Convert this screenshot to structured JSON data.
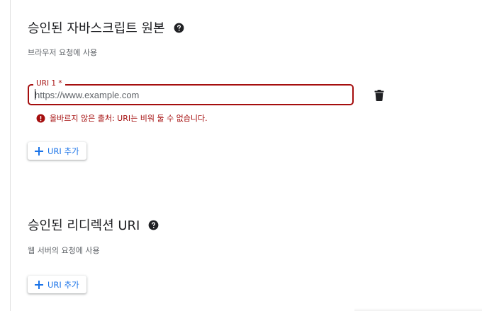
{
  "origins_section": {
    "title": "승인된 자바스크립트 원본",
    "description": "브라우저 요청에 사용",
    "uri_field": {
      "label": "URI 1 *",
      "value": "",
      "placeholder": "https://www.example.com"
    },
    "error_text": "올바르지 않은 출처: URI는 비워 둘 수 없습니다.",
    "add_button_label": "URI 추가"
  },
  "redirect_section": {
    "title": "승인된 리디렉션 URI",
    "description": "웹 서버의 요청에 사용",
    "add_button_label": "URI 추가"
  },
  "colors": {
    "error": "#a50e0e",
    "accent": "#1a73e8",
    "text_primary": "#202124",
    "text_secondary": "#5f6368"
  },
  "icons": {
    "help": "help-circle-icon",
    "delete": "trash-icon",
    "error": "error-circle-icon",
    "add": "plus-icon"
  }
}
